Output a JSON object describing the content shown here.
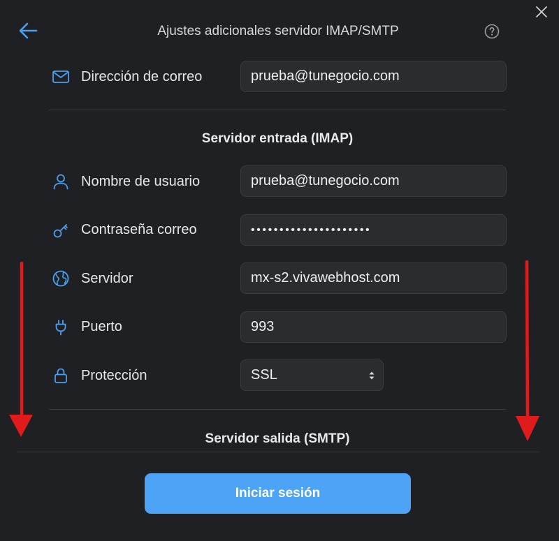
{
  "header": {
    "title": "Ajustes adicionales servidor IMAP/SMTP"
  },
  "email": {
    "label": "Dirección de correo",
    "value": "prueba@tunegocio.com"
  },
  "imap": {
    "section_title": "Servidor entrada (IMAP)",
    "username": {
      "label": "Nombre de usuario",
      "value": "prueba@tunegocio.com"
    },
    "password": {
      "label": "Contraseña correo",
      "value": "•••••••••••••••••••••"
    },
    "server": {
      "label": "Servidor",
      "value": "mx-s2.vivawebhost.com"
    },
    "port": {
      "label": "Puerto",
      "value": "993"
    },
    "protection": {
      "label": "Protección",
      "value": "SSL"
    }
  },
  "smtp": {
    "section_title": "Servidor salida (SMTP)"
  },
  "footer": {
    "login_label": "Iniciar sesión"
  },
  "colors": {
    "background": "#1f2023",
    "accent": "#4da3f5",
    "icon_blue": "#4aa0ee",
    "annotation_arrow": "#e01b1b"
  },
  "icons": {
    "close": "close-icon",
    "back": "arrow-left-icon",
    "help": "help-circle-icon",
    "email": "envelope-icon",
    "user": "user-icon",
    "password": "key-icon",
    "server": "globe-icon",
    "port": "plug-icon",
    "protection": "lock-icon",
    "select": "up-down-caret-icon"
  }
}
